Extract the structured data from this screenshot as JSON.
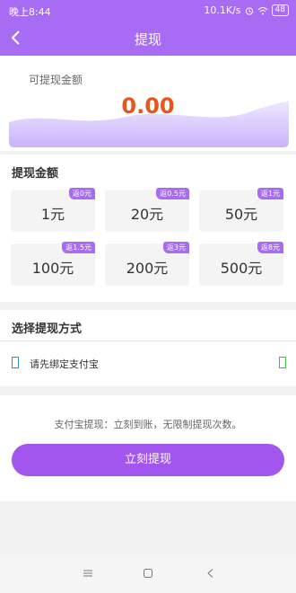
{
  "status": {
    "time": "晚上8:44",
    "network": "10.1K/s",
    "battery": "48"
  },
  "header": {
    "title": "提现"
  },
  "balance": {
    "label": "可提现金额",
    "amount": "0.00"
  },
  "amount_section": {
    "title": "提现金额",
    "options": [
      {
        "value": "1元",
        "rebate": "返0元"
      },
      {
        "value": "20元",
        "rebate": "返0.5元"
      },
      {
        "value": "50元",
        "rebate": "返1元"
      },
      {
        "value": "100元",
        "rebate": "返1.5元"
      },
      {
        "value": "200元",
        "rebate": "返3元"
      },
      {
        "value": "500元",
        "rebate": "返8元"
      }
    ]
  },
  "pay_section": {
    "title": "选择提现方式",
    "method_label": "请先绑定支付宝"
  },
  "bottom": {
    "note": "支付宝提现：立刻到账，无限制提现次数。",
    "submit_label": "立刻提现"
  },
  "colors": {
    "brand": "#a76cf3",
    "button": "#a256ee",
    "amount": "#e8561c"
  }
}
